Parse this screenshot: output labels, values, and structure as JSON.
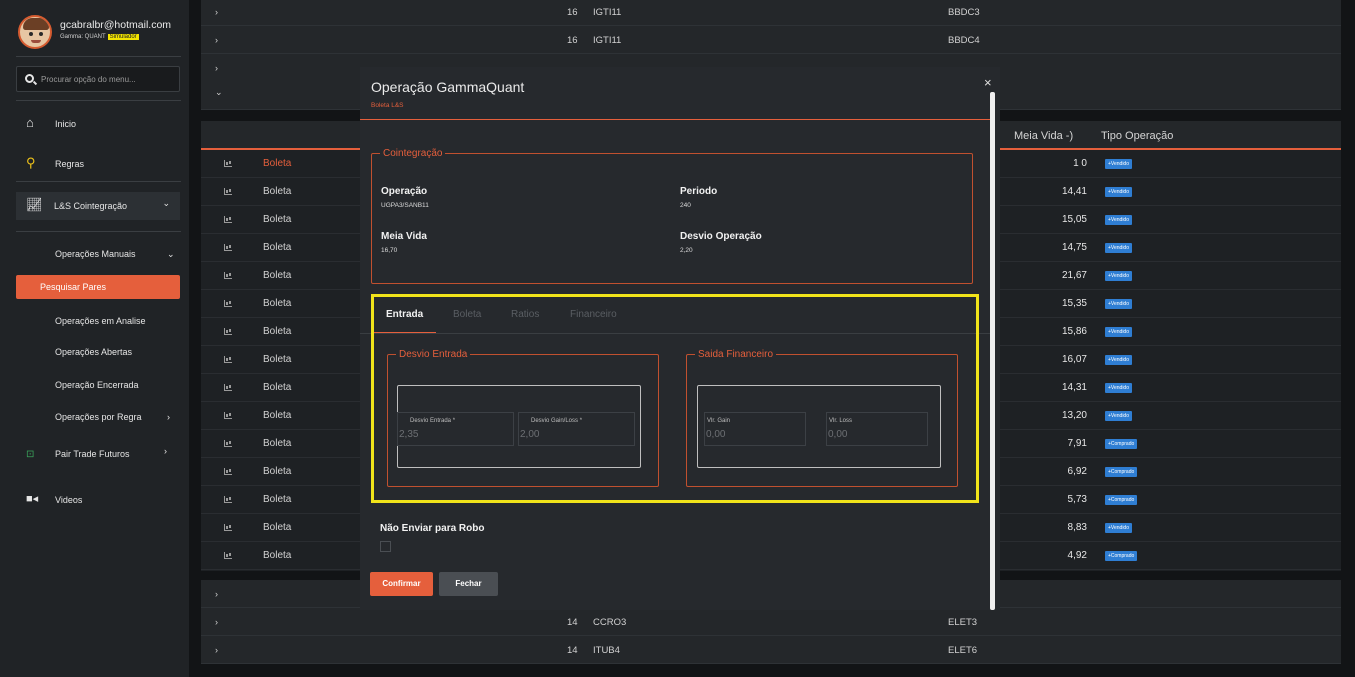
{
  "user": {
    "email": "gcabralbr@hotmail.com",
    "plan_label": "Gamma: QUANT",
    "plan_badge": "Simulador"
  },
  "search": {
    "placeholder": "Procurar opção do menu..."
  },
  "nav": {
    "inicio": "Inicio",
    "regras": "Regras",
    "lbs": "L&S Cointegração",
    "operacoes_manuais": "Operações Manuais",
    "pesquisar_pares": "Pesquisar Pares",
    "em_analise": "Operações em Analise",
    "abertas": "Operações Abertas",
    "encerrada": "Operação Encerrada",
    "por_regra": "Operações por Regra",
    "pair_trade": "Pair Trade Futuros",
    "videos": "Videos"
  },
  "bg_rows": [
    {
      "num": "16",
      "t1": "IGTI11",
      "t2": "BBDC3"
    },
    {
      "num": "16",
      "t1": "IGTI11",
      "t2": "BBDC4"
    },
    {
      "num": "",
      "t1": "",
      "t2": ""
    },
    {
      "num": "",
      "t1": "",
      "t2": ""
    }
  ],
  "bg_rows_bottom": [
    {
      "num": "",
      "t1": "",
      "t2": ""
    },
    {
      "num": "14",
      "t1": "CCRO3",
      "t2": "ELET3"
    },
    {
      "num": "14",
      "t1": "ITUB4",
      "t2": "ELET6"
    }
  ],
  "table": {
    "col_meia_vida": "Meia Vida",
    "sort_indicator": "-)",
    "col_tipo": "Tipo Operação",
    "rows": [
      {
        "label": "Boleta",
        "meia_vida": "1 0",
        "tipo": "+Vendido"
      },
      {
        "label": "Boleta",
        "meia_vida": "14,41",
        "tipo": "+Vendido"
      },
      {
        "label": "Boleta",
        "meia_vida": "15,05",
        "tipo": "+Vendido"
      },
      {
        "label": "Boleta",
        "meia_vida": "14,75",
        "tipo": "+Vendido"
      },
      {
        "label": "Boleta",
        "meia_vida": "21,67",
        "tipo": "+Vendido"
      },
      {
        "label": "Boleta",
        "meia_vida": "15,35",
        "tipo": "+Vendido"
      },
      {
        "label": "Boleta",
        "meia_vida": "15,86",
        "tipo": "+Vendido"
      },
      {
        "label": "Boleta",
        "meia_vida": "16,07",
        "tipo": "+Vendido"
      },
      {
        "label": "Boleta",
        "meia_vida": "14,31",
        "tipo": "+Vendido"
      },
      {
        "label": "Boleta",
        "meia_vida": "13,20",
        "tipo": "+Vendido"
      },
      {
        "label": "Boleta",
        "meia_vida": "7,91",
        "tipo": "+Comprado"
      },
      {
        "label": "Boleta",
        "meia_vida": "6,92",
        "tipo": "+Comprado"
      },
      {
        "label": "Boleta",
        "meia_vida": "5,73",
        "tipo": "+Comprado"
      },
      {
        "label": "Boleta",
        "meia_vida": "8,83",
        "tipo": "+Vendido"
      },
      {
        "label": "Boleta",
        "meia_vida": "4,92",
        "tipo": "+Comprado"
      }
    ]
  },
  "modal": {
    "title": "Operação GammaQuant",
    "close": "×",
    "subtitle": "Boleta L&S",
    "cointegracao": {
      "legend": "Cointegração",
      "operacao_label": "Operação",
      "operacao_value": "UGPA3/SANB11",
      "periodo_label": "Periodo",
      "periodo_value": "240",
      "meia_vida_label": "Meia Vida",
      "meia_vida_value": "16,70",
      "desvio_label": "Desvio Operação",
      "desvio_value": "2,20"
    },
    "tabs": [
      "Entrada",
      "Boleta",
      "Ratios",
      "Financeiro"
    ],
    "desvio_entrada": {
      "legend": "Desvio Entrada",
      "field1_label": "Desvio Entrada *",
      "field1_value": "2,35",
      "field2_label": "Desvio Gain/Loss *",
      "field2_value": "2,00"
    },
    "saida_financeiro": {
      "legend": "Saida Financeiro",
      "field1_label": "Vlr. Gain",
      "field1_value": "0,00",
      "field2_label": "Vlr. Loss",
      "field2_value": "0,00"
    },
    "nao_enviar": "Não Enviar para Robo",
    "confirmar": "Confirmar",
    "fechar": "Fechar"
  },
  "colors": {
    "accent": "#e55f3c",
    "highlight": "#f0e31a",
    "tag_blue": "#2f7ed3",
    "sidebar": "#202326"
  }
}
